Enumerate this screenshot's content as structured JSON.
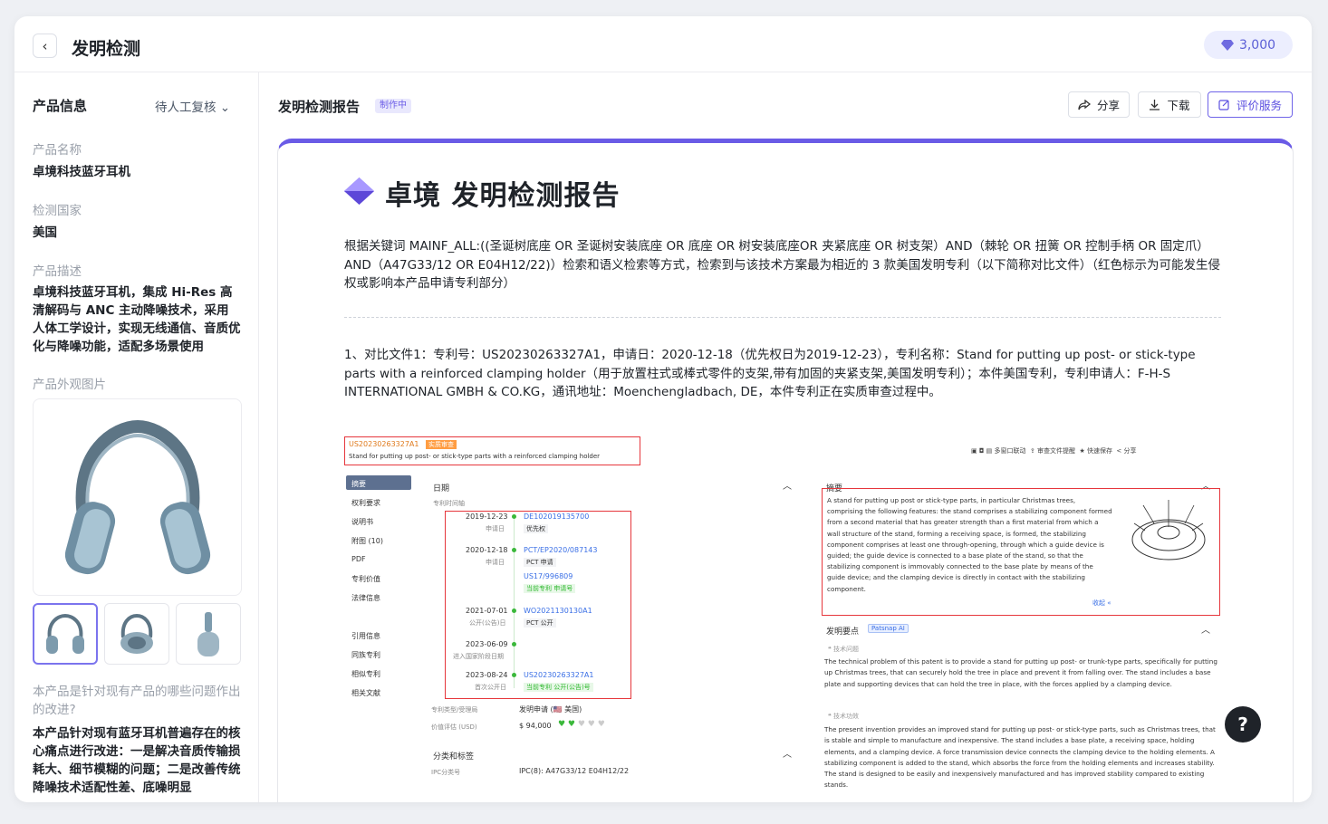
{
  "topbar": {
    "title": "发明检测",
    "credits": "3,000"
  },
  "sidebar": {
    "heading": "产品信息",
    "status": "待人工复核",
    "name_label": "产品名称",
    "name_value": "卓境科技蓝牙耳机",
    "country_label": "检测国家",
    "country_value": "美国",
    "desc_label": "产品描述",
    "desc_value": "卓境科技蓝牙耳机，集成 Hi-Res 高清解码与 ANC 主动降噪技术，采用人体工学设计，实现无线通信、音质优化与降噪功能，适配多场景使用",
    "image_label": "产品外观图片",
    "question_label": "本产品是针对现有产品的哪些问题作出的改进?",
    "answer_value": "本产品针对现有蓝牙耳机普遍存在的核心痛点进行改进：一是解决音质传输损耗大、细节模糊的问题；二是改善传统降噪技术适配性差、底噪明显"
  },
  "main": {
    "report_heading": "发明检测报告",
    "badge": "制作中",
    "share_label": "分享",
    "download_label": "下载",
    "evaluate_label": "评价服务"
  },
  "report": {
    "title": "卓境  发明检测报告",
    "intro": "根据关键词 MAINF_ALL:((圣诞树底座 OR 圣诞树安装底座 OR 底座 OR 树安装底座OR 夹紧底座 OR 树支架）AND（棘轮 OR 扭簧 OR 控制手柄 OR 固定爪）AND（A47G33/12 OR E04H12/22)）检索和语义检索等方式，检索到与该技术方案最为相近的 3 款美国发明专利（以下简称对比文件）（红色标示为可能发生侵权或影响本产品申请专利部分）",
    "item1": "1、对比文件1：专利号：US20230263327A1，申请日：2020-12-18（优先权日为2019-12-23），专利名称：Stand for putting up post- or stick-type parts with a reinforced clamping holder（用于放置柱式或棒式零件的支架,带有加固的夹紧支架,美国发明专利）；本件美国专利，专利申请人：F-H-S INTERNATIONAL GMBH & CO.KG，通讯地址：Moenchengladbach, DE，本件专利正在实质审查过程中。"
  },
  "shot": {
    "patent_no": "US20230263327A1",
    "status_tag": "实质审查",
    "patent_title": "Stand for putting up post- or stick-type parts with a reinforced clamping holder",
    "toolbar": [
      "多窗口联动",
      "审查文件提醒",
      "快速保存",
      "分享"
    ],
    "nav": [
      "摘要",
      "权利要求",
      "说明书",
      "附图 (10)",
      "PDF",
      "专利价值",
      "法律信息",
      "引用信息",
      "同族专利",
      "相似专利",
      "相关文献"
    ],
    "dates_title": "日期",
    "timeline_label": "专利时间轴",
    "timeline": [
      {
        "date": "2019-12-23",
        "sub": "申请日",
        "num": "DE102019135700",
        "tag": "优先权"
      },
      {
        "date": "2020-12-18",
        "sub": "申请日",
        "num": "PCT/EP2020/087143",
        "tag": "PCT 申请"
      },
      {
        "date": "",
        "sub": "",
        "num": "US17/996809",
        "tag": "当前专利  申请号"
      },
      {
        "date": "2021-07-01",
        "sub": "公开(公告)日",
        "num": "WO2021130130A1",
        "tag": "PCT 公开"
      },
      {
        "date": "2023-06-09",
        "sub": "进入国家阶段日期",
        "num": "",
        "tag": ""
      },
      {
        "date": "2023-08-24",
        "sub": "首次公开日",
        "num": "US20230263327A1",
        "tag": "当前专利  公开(公告)号"
      }
    ],
    "type_label": "专利类型/受理局",
    "type_value": "发明申请 (🇺🇸 美国)",
    "value_label": "价值评估 (USD)",
    "value_value": "$ 94,000",
    "class_title": "分类和标签",
    "ipc_label": "IPC分类号",
    "ipc_value": "IPC(8): A47G33/12  E04H12/22",
    "abstract_title": "摘要",
    "abstract": "A stand for putting up post or stick-type parts, in particular Christmas trees, comprising the following features: the stand comprises a stabilizing component formed from a second material that has greater strength than a first material from which a wall structure of the stand, forming a receiving space, is formed, the stabilizing component comprises at least one through-opening, through which a guide device is guided; the guide device is connected to a base plate of the stand, so that the stabilizing component is immovably connected to the base plate by means of the guide device; and the clamping device is directly in contact with the stabilizing component.",
    "collapse": "收起 «",
    "key_title": "发明要点",
    "key_tag": "Patsnap AI",
    "problem_label": "技术问题",
    "problem": "The technical problem of this patent is to provide a stand for putting up post- or trunk-type parts, specifically for putting up Christmas trees, that can securely hold the tree in place and prevent it from falling over. The stand includes a base plate and supporting devices that can hold the tree in place, with the forces applied by a clamping device.",
    "effect_label": "技术功效",
    "effect": "The present invention provides an improved stand for putting up post- or stick-type parts, such as Christmas trees, that is stable and simple to manufacture and inexpensive. The stand includes a base plate, a receiving space, holding elements, and a clamping device. A force transmission device connects the clamping device to the holding elements. A stabilizing component is added to the stand, which absorbs the force from the holding elements and increases stability. The stand is designed to be easily and inexpensively manufactured and has improved stability compared to existing stands."
  },
  "help": "?",
  "colors": {
    "accent": "#6a5be6",
    "red": "#e6363c",
    "credit_bg": "#eceefe"
  }
}
